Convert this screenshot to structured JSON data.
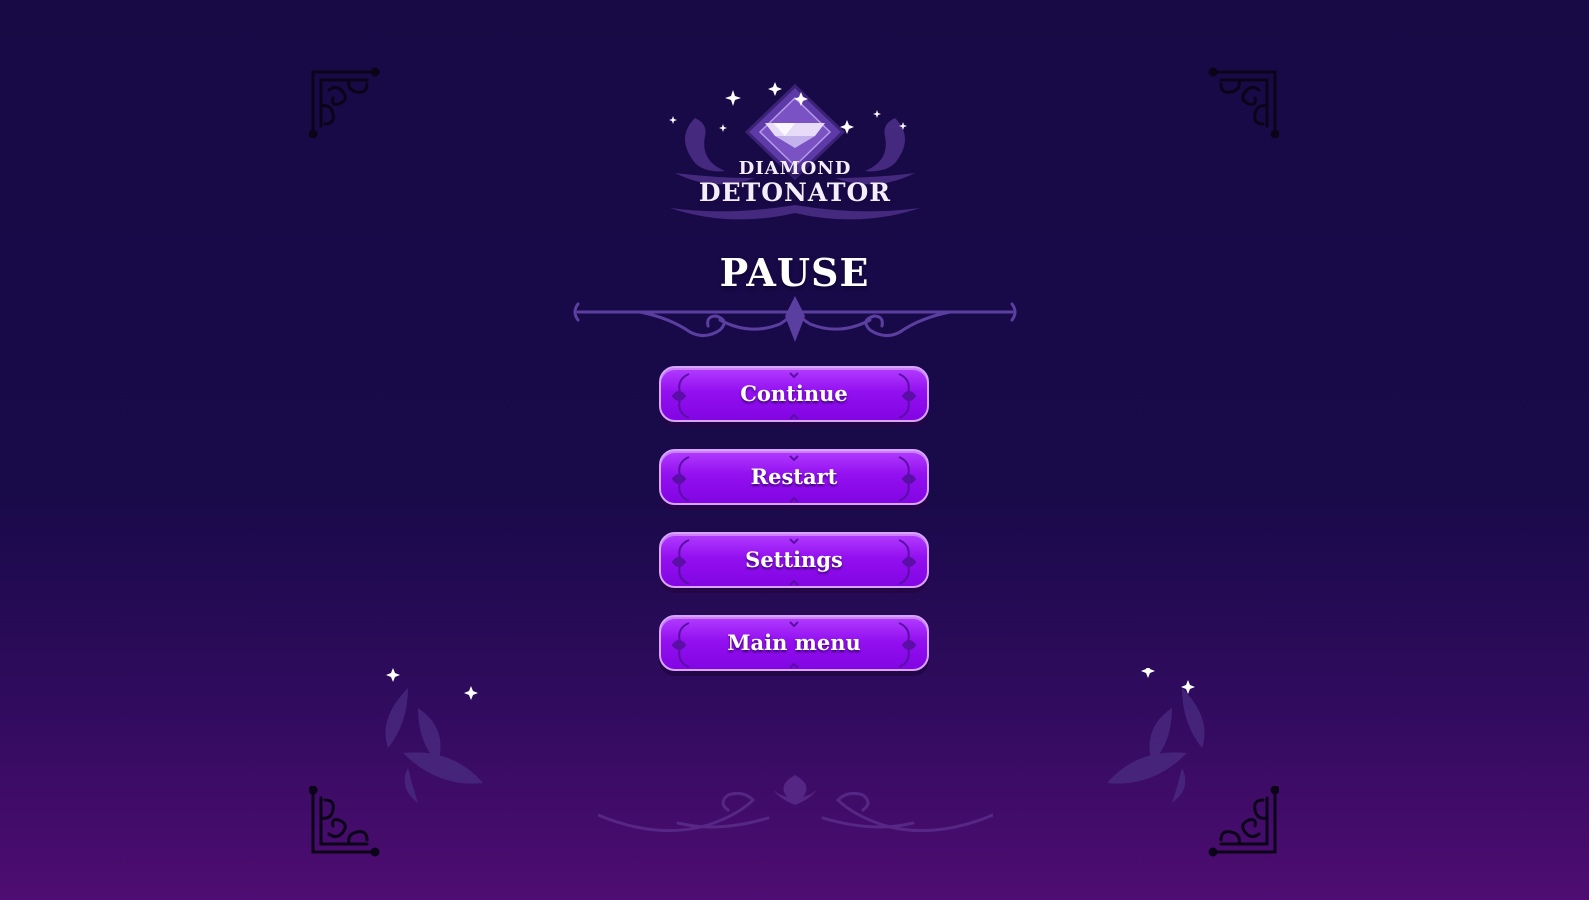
{
  "game": {
    "logo_line1": "DIAMOND",
    "logo_line2": "DETONATOR"
  },
  "pause_menu": {
    "title": "PAUSE",
    "buttons": [
      {
        "label": "Continue"
      },
      {
        "label": "Restart"
      },
      {
        "label": "Settings"
      },
      {
        "label": "Main menu"
      }
    ]
  },
  "colors": {
    "background_top": "#170a45",
    "background_bottom": "#4f0d72",
    "button_fill": "#9410f0",
    "button_border": "#d9a4ff",
    "ornament": "#5a3a9a"
  },
  "icons": {
    "corners": "ornate-corner-icon",
    "logo_gem": "diamond-icon",
    "sparkles": "sparkle-icon"
  }
}
